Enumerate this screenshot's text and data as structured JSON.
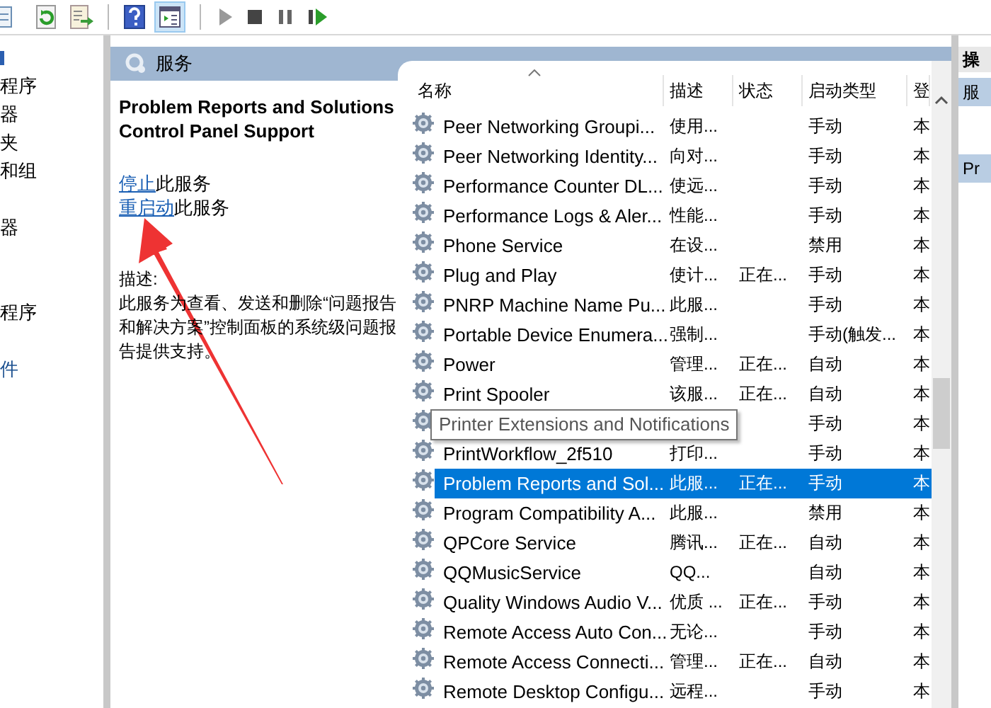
{
  "tree": {
    "items": [
      "程序",
      "器",
      "夹",
      "和组",
      "器",
      "程序",
      "件"
    ]
  },
  "services": {
    "title": "服务",
    "detail": {
      "name": "Problem Reports and Solutions Control Panel Support",
      "actions": [
        {
          "link": "停止",
          "rest": "此服务"
        },
        {
          "link": "重启动",
          "rest": "此服务"
        }
      ],
      "description_label": "描述:",
      "description": "此服务为查看、发送和删除“问题报告和解决方案”控制面板的系统级问题报告提供支持。"
    },
    "columns": [
      {
        "label": "名称",
        "sorted": true
      },
      {
        "label": "描述",
        "sorted": false
      },
      {
        "label": "状态",
        "sorted": false
      },
      {
        "label": "启动类型",
        "sorted": false
      },
      {
        "label": "登",
        "sorted": false
      }
    ],
    "rows": [
      {
        "name": "Peer Networking Groupi...",
        "description": "使用...",
        "startup": "手动",
        "column_5": "本",
        "selected": false
      },
      {
        "name": "Peer Networking Identity...",
        "description": "向对...",
        "startup": "手动",
        "column_5": "本",
        "selected": false
      },
      {
        "name": "Performance Counter DL...",
        "description": "使远...",
        "startup": "手动",
        "column_5": "本",
        "selected": false
      },
      {
        "name": "Performance Logs & Aler...",
        "description": "性能...",
        "startup": "手动",
        "column_5": "本",
        "selected": false
      },
      {
        "name": "Phone Service",
        "description": "在设...",
        "startup": "禁用",
        "column_5": "本",
        "selected": false
      },
      {
        "name": "Plug and Play",
        "description": "使计...",
        "status": "正在...",
        "startup": "手动",
        "column_5": "本",
        "selected": false
      },
      {
        "name": "PNRP Machine Name Pu...",
        "description": "此服...",
        "startup": "手动",
        "column_5": "本",
        "selected": false
      },
      {
        "name": "Portable Device Enumera...",
        "description": "强制...",
        "startup": "手动(触发...",
        "column_5": "本",
        "selected": false
      },
      {
        "name": "Power",
        "description": "管理...",
        "status": "正在...",
        "startup": "自动",
        "column_5": "本",
        "selected": false
      },
      {
        "name": "Print Spooler",
        "description": "该服...",
        "status": "正在...",
        "startup": "自动",
        "column_5": "本",
        "selected": false
      },
      {
        "tooltip": "Printer Extensions and Notifications",
        "startup": "手动",
        "column_5": "本",
        "selected": false
      },
      {
        "name": "PrintWorkflow_2f510",
        "description": "打印...",
        "startup": "手动",
        "column_5": "本",
        "selected": false
      },
      {
        "name": "Problem Reports and Sol...",
        "description": "此服...",
        "status": "正在...",
        "startup": "手动",
        "column_5": "本",
        "selected": true
      },
      {
        "name": "Program Compatibility A...",
        "description": "此服...",
        "startup": "禁用",
        "column_5": "本",
        "selected": false
      },
      {
        "name": "QPCore Service",
        "description": "腾讯...",
        "status": "正在...",
        "startup": "自动",
        "column_5": "本",
        "selected": false
      },
      {
        "name": "QQMusicService",
        "description": "QQ...",
        "startup": "自动",
        "column_5": "本",
        "selected": false
      },
      {
        "name": "Quality Windows Audio V...",
        "description": "优质 ...",
        "status": "正在...",
        "startup": "手动",
        "column_5": "本",
        "selected": false
      },
      {
        "name": "Remote Access Auto Con...",
        "description": "无论...",
        "startup": "手动",
        "column_5": "本",
        "selected": false
      },
      {
        "name": "Remote Access Connecti...",
        "description": "管理...",
        "status": "正在...",
        "startup": "自动",
        "column_5": "本",
        "selected": false
      },
      {
        "name": "Remote Desktop Configu...",
        "description": "远程...",
        "startup": "手动",
        "column_5": "本",
        "selected": false
      }
    ]
  },
  "actions": {
    "header": "操",
    "items": [
      "服",
      "Pr"
    ]
  }
}
